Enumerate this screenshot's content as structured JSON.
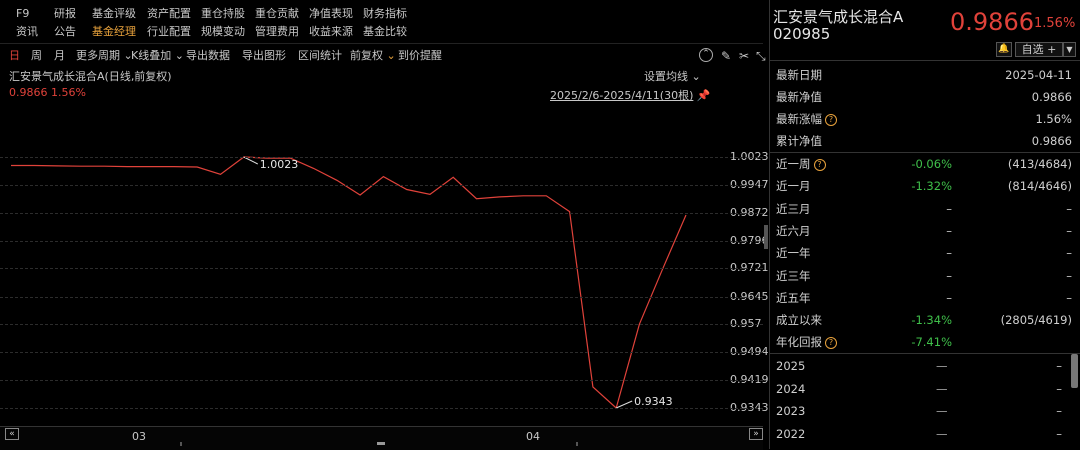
{
  "menu": {
    "row1": [
      "F9",
      "研报",
      "基金评级",
      "资产配置",
      "重仓持股",
      "重仓贡献",
      "净值表现",
      "财务指标"
    ],
    "row2": [
      "资讯",
      "公告",
      "基金经理",
      "行业配置",
      "规模变动",
      "管理费用",
      "收益来源",
      "基金比较"
    ],
    "active_row2_index": 2
  },
  "toolbar": {
    "items": [
      "日",
      "周",
      "月",
      "更多周期",
      "K线叠加",
      "导出数据",
      "导出图形",
      "区间统计",
      "前复权",
      "到价提醒"
    ],
    "active": [
      "日",
      "前复权"
    ]
  },
  "chart_header": {
    "title": "汇安景气成长混合A(日线,前复权)",
    "value_line": "0.9866 1.56%",
    "ma_setting": "设置均线",
    "range_label": "2025/2/6-2025/4/11(30根)"
  },
  "chart_data": {
    "type": "line",
    "series": [
      {
        "values": [
          1.0,
          1.0,
          0.9999,
          0.9998,
          0.9998,
          0.9997,
          0.9997,
          0.9997,
          0.9996,
          0.9976,
          1.0023,
          1.002,
          1.002,
          0.9992,
          0.996,
          0.992,
          0.997,
          0.9935,
          0.9922,
          0.9968,
          0.991,
          0.9915,
          0.9918,
          0.9918,
          0.9875,
          0.94,
          0.9343,
          0.957,
          0.972,
          0.9866
        ]
      }
    ],
    "x_ticks": [
      "03",
      "04"
    ],
    "y_ticks": [
      1.0023,
      0.9947,
      0.9872,
      0.9796,
      0.9721,
      0.9645,
      0.957,
      0.9494,
      0.9419,
      0.9343
    ],
    "ylim": [
      0.9343,
      1.0023
    ],
    "annotations": [
      {
        "label": "1.0023"
      },
      {
        "label": "0.9343"
      }
    ],
    "grid": true,
    "line_color": "#e0423a"
  },
  "fund": {
    "name": "汇安景气成长混合A",
    "code": "020985",
    "price": "0.9866",
    "change": "1.56%",
    "select_label": "自选 +"
  },
  "info": [
    {
      "label": "最新日期",
      "value": "2025-04-11",
      "color": "normal"
    },
    {
      "label": "最新净值",
      "value": "0.9866",
      "color": "red"
    },
    {
      "label": "最新涨幅",
      "value": "1.56%",
      "color": "red",
      "help": true
    },
    {
      "label": "累计净值",
      "value": "0.9866",
      "color": "normal"
    }
  ],
  "periods": [
    {
      "label": "近一周",
      "help": true,
      "pct": "-0.06%",
      "rank": "(413/4684)"
    },
    {
      "label": "近一月",
      "help": false,
      "pct": "-1.32%",
      "rank": "(814/4646)"
    },
    {
      "label": "近三月",
      "help": false,
      "pct": "",
      "rank": "–"
    },
    {
      "label": "近六月",
      "help": false,
      "pct": "",
      "rank": "–"
    },
    {
      "label": "近一年",
      "help": false,
      "pct": "",
      "rank": "–"
    },
    {
      "label": "近三年",
      "help": false,
      "pct": "",
      "rank": "–"
    },
    {
      "label": "近五年",
      "help": false,
      "pct": "",
      "rank": "–"
    },
    {
      "label": "成立以来",
      "help": false,
      "pct": "-1.34%",
      "rank": "(2805/4619)"
    },
    {
      "label": "年化回报",
      "help": true,
      "pct": "-7.41%",
      "rank": ""
    }
  ],
  "years": [
    {
      "year": "2025",
      "a": "—",
      "b": "–"
    },
    {
      "year": "2024",
      "a": "—",
      "b": "–"
    },
    {
      "year": "2023",
      "a": "—",
      "b": "–"
    },
    {
      "year": "2022",
      "a": "—",
      "b": "–"
    }
  ],
  "dash_mark": "–",
  "help_glyph": "?"
}
